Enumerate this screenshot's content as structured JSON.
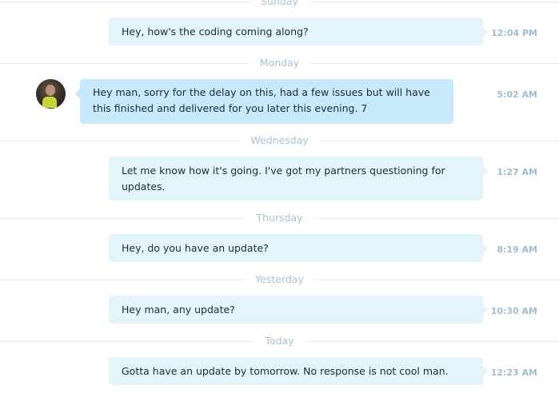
{
  "days": {
    "sunday": "Sunday",
    "monday": "Monday",
    "wednesday": "Wednesday",
    "thursday": "Thursday",
    "yesterday": "Yesterday",
    "today": "Today"
  },
  "messages": [
    {
      "text": "Hey, how's the coding coming along?",
      "time": "12:04 PM",
      "direction": "outgoing"
    },
    {
      "text": "Hey man, sorry for the delay on this, had a few issues but will have this finished and delivered for you later this evening. 7",
      "time": "5:02 AM",
      "direction": "incoming"
    },
    {
      "text": "Let me know how it's going. I've got my partners questioning for updates.",
      "time": "1:27 AM",
      "direction": "outgoing"
    },
    {
      "text": "Hey, do you have an update?",
      "time": "8:19 AM",
      "direction": "outgoing"
    },
    {
      "text": "Hey man, any update?",
      "time": "10:30 AM",
      "direction": "outgoing"
    },
    {
      "text": "Gotta have an update by tomorrow. No response is not cool man.",
      "time": "12:23 AM",
      "direction": "outgoing"
    }
  ],
  "colors": {
    "outgoing_bubble": "#e4f4fc",
    "incoming_bubble": "#c7e9fb",
    "timestamp": "#9fbdd0",
    "day_label": "#a9c2d3"
  }
}
